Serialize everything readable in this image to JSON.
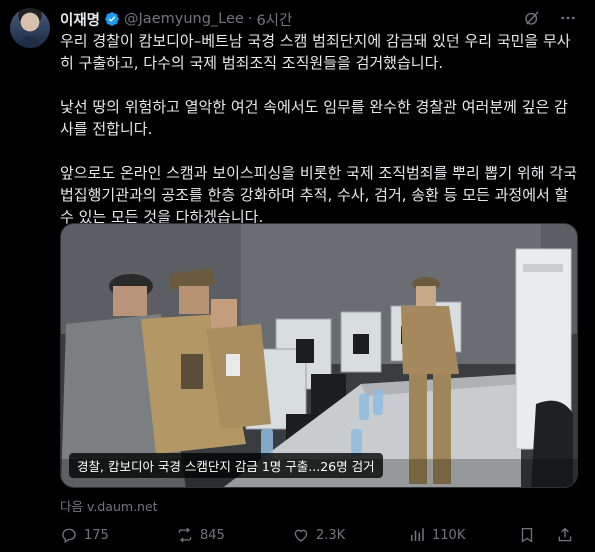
{
  "author": {
    "name": "이재명",
    "handle": "@Jaemyung_Lee",
    "separator": "·",
    "time": "6시간"
  },
  "tweet": {
    "paragraphs": [
      "우리 경찰이 캄보디아–베트남 국경 스캠 범죄단지에 감금돼 있던 우리 국민을 무사히 구출하고, 다수의 국제 범죄조직 조직원들을 검거했습니다.",
      "낯선 땅의 위험하고 열악한 여건 속에서도 임무를 완수한 경찰관 여러분께 깊은 감사를 전합니다.",
      "앞으로도 온라인 스캠과 보이스피싱을 비롯한 국제 조직범죄를 뿌리 뽑기 위해 각국 법집행기관과의 공조를 한층 강화하며 추적, 수사, 검거, 송환 등 모든 과정에서 할 수 있는 모든 것을 다하겠습니다."
    ]
  },
  "card": {
    "caption": "경찰, 캄보디아 국경 스캠단지 감금 1명 구출...26명 검거",
    "source": "다음 v.daum.net"
  },
  "actions": {
    "replies": "175",
    "reposts": "845",
    "likes": "2.3K",
    "views": "110K"
  },
  "colors": {
    "background": "#000000",
    "text": "#e7e9ea",
    "muted": "#71767b",
    "verified": "#1d9bf0"
  },
  "icons": [
    "verified-badge-icon",
    "grok-icon",
    "more-icon",
    "reply-icon",
    "repost-icon",
    "like-icon",
    "views-icon"
  ]
}
